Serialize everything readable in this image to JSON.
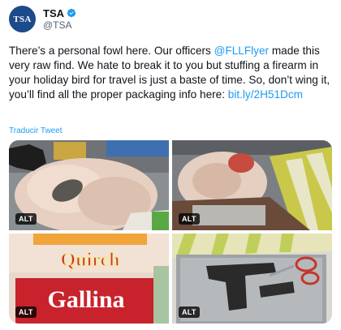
{
  "account": {
    "avatar_text": "TSA",
    "display_name": "TSA",
    "handle": "@TSA",
    "verified_icon": "verified-badge-icon"
  },
  "tweet": {
    "text_before_mention": "There’s a personal fowl here. Our officers ",
    "mention": "@FLLFlyer",
    "text_after_mention": " made this very raw find. We hate to break it to you but stuffing a firearm in your holiday bird for travel is just a baste of time. So, don’t wing it, you’ll find all the proper packaging info here: ",
    "link": "bit.ly/2H51Dcm"
  },
  "translate_label": "Traducir Tweet",
  "media": {
    "photos": [
      {
        "alt_badge": "ALT"
      },
      {
        "alt_badge": "ALT"
      },
      {
        "alt_badge": "ALT",
        "package_text_top": "Quirch",
        "package_text_bottom": "Gallina"
      },
      {
        "alt_badge": "ALT"
      }
    ]
  },
  "colors": {
    "link": "#1d9bf0",
    "text": "#0f1419",
    "secondary": "#536471",
    "avatar_bg": "#1c4a8a"
  }
}
